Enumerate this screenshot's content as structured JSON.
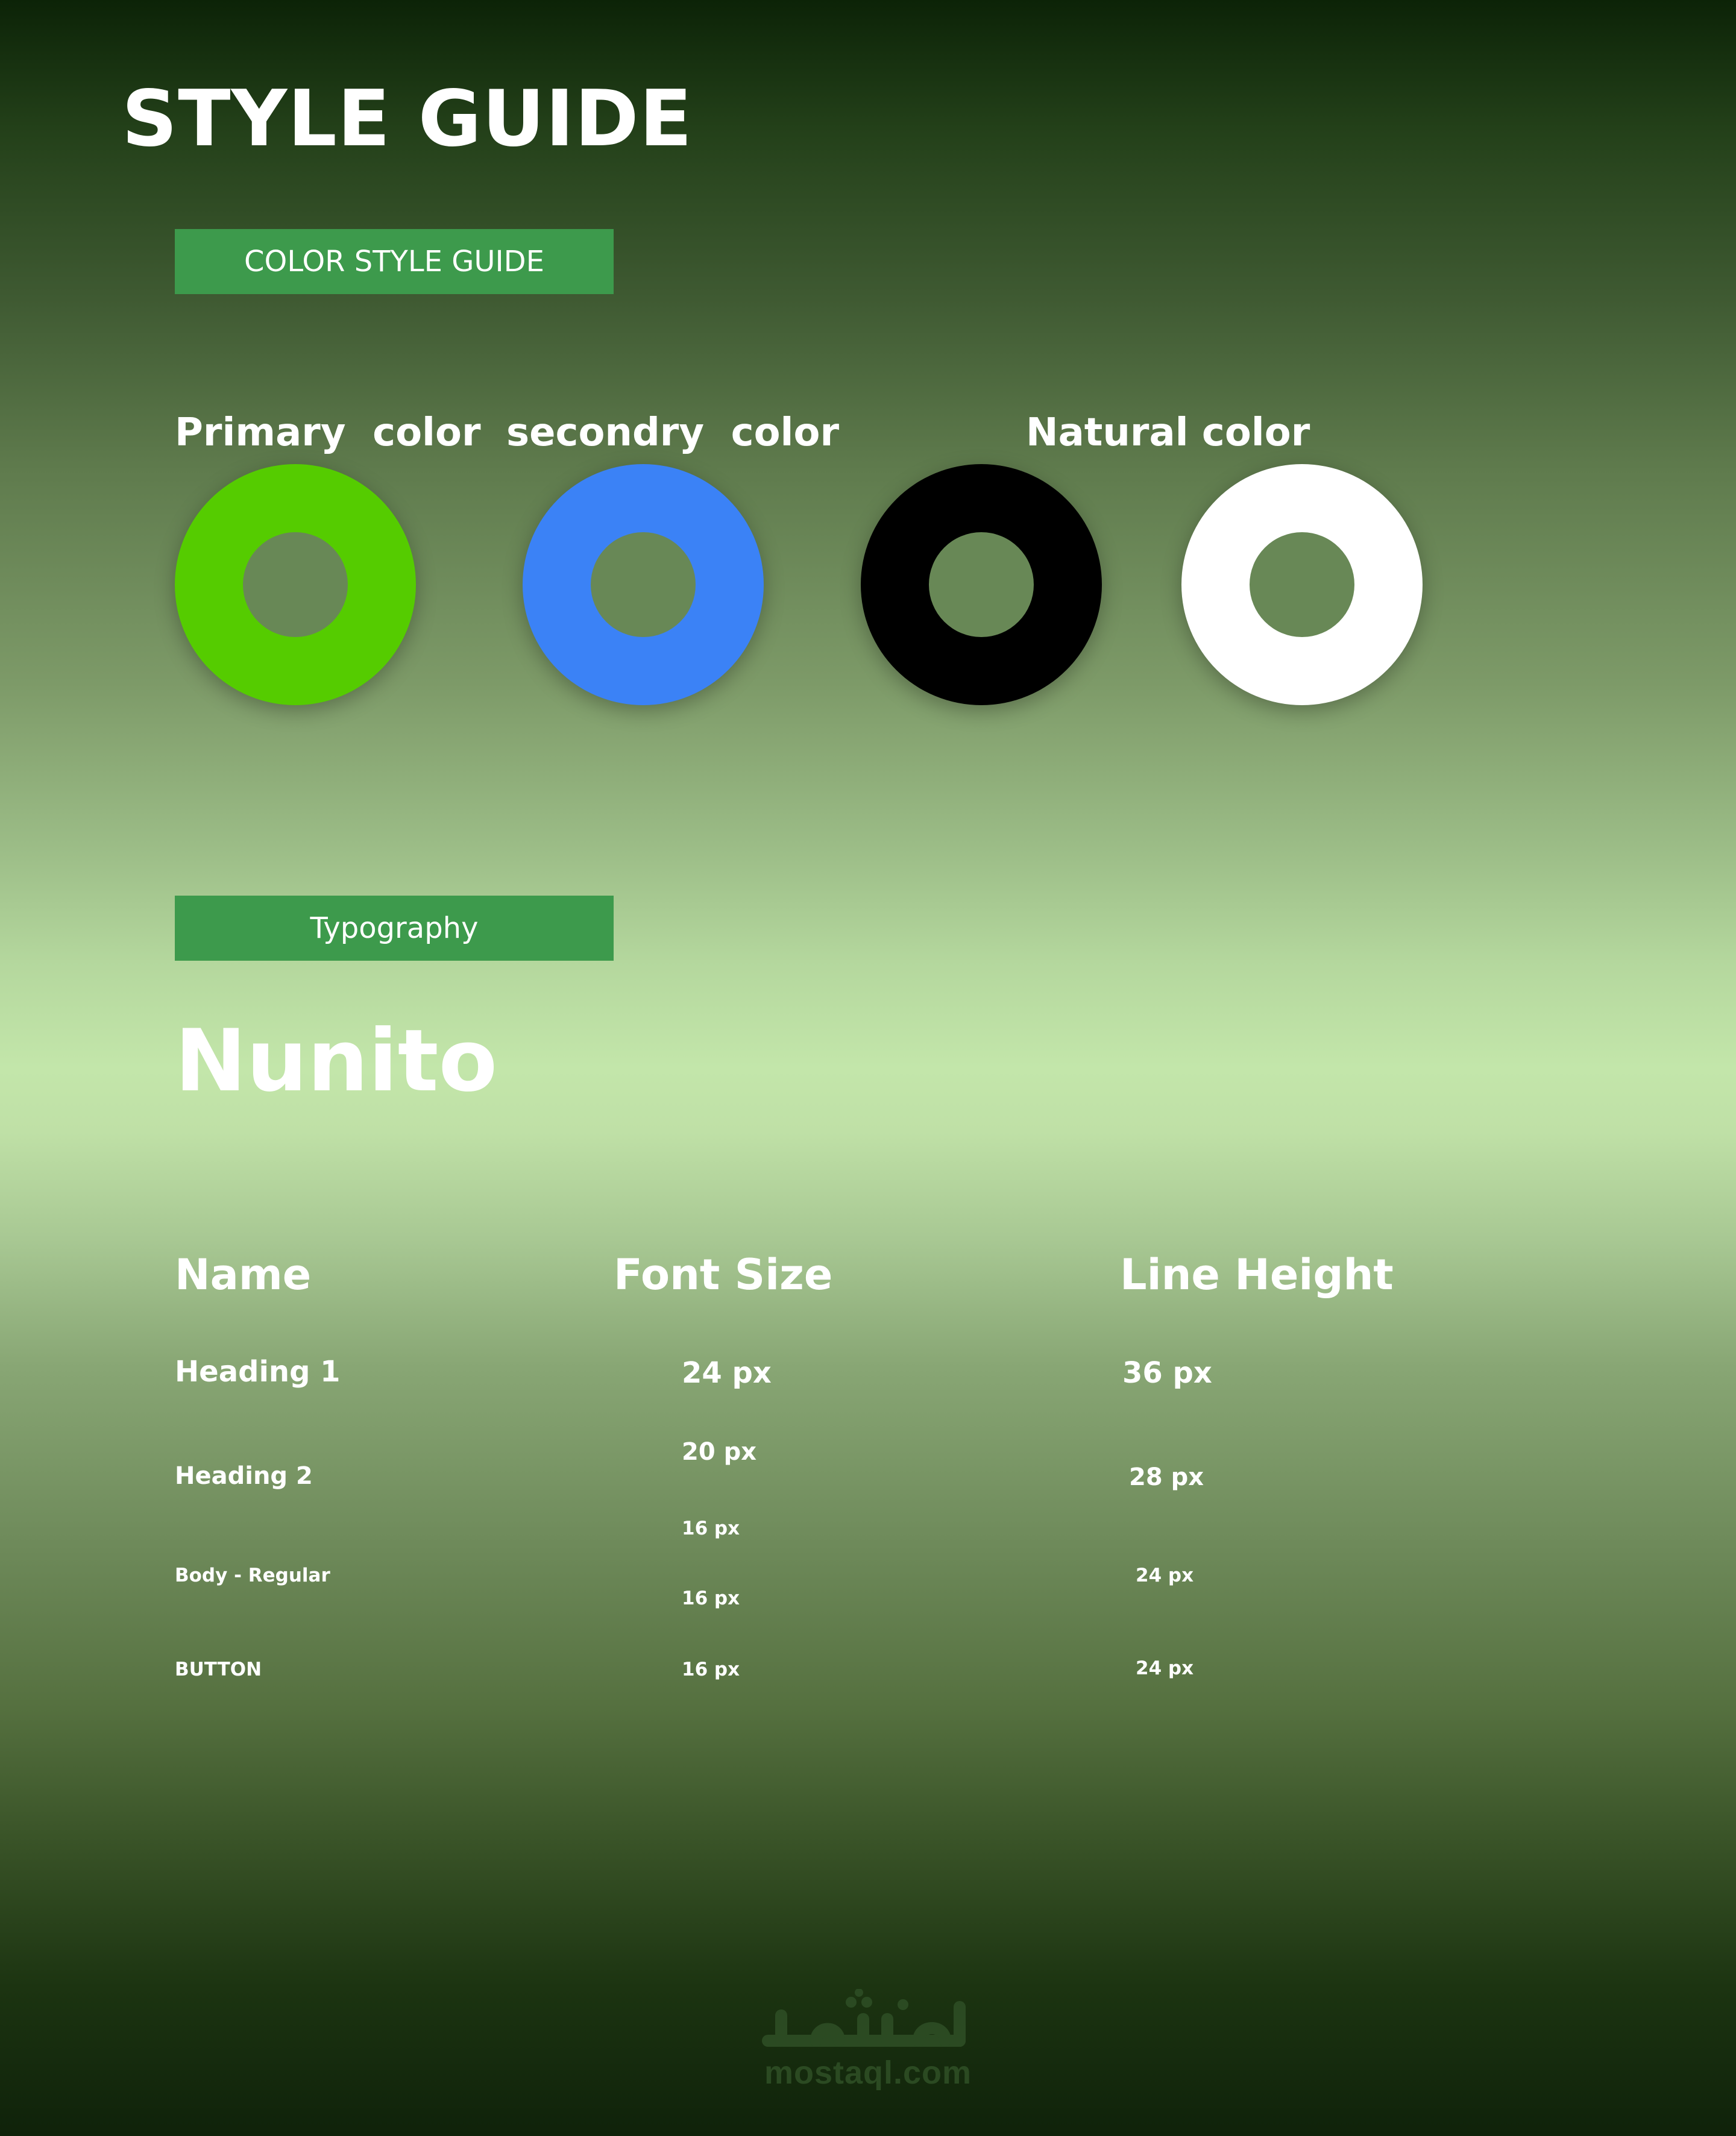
{
  "header": {
    "title": "STYLE GUIDE"
  },
  "color_section": {
    "label": "COLOR STYLE GUIDE",
    "primary_label": "Primary  color",
    "secondary_label": "secondry  color",
    "neutral_label": "Natural color",
    "swatches": [
      {
        "name": "primary",
        "color": "#55cc00"
      },
      {
        "name": "secondary",
        "color": "#3b82f6"
      },
      {
        "name": "neutral-black",
        "color": "#000000"
      },
      {
        "name": "neutral-white",
        "color": "#ffffff"
      }
    ]
  },
  "typography_section": {
    "label": "Typography",
    "font_name": "Nunito",
    "columns": {
      "name": "Name",
      "font_size": "Font Size",
      "line_height": "Line Height"
    },
    "rows": [
      {
        "name": "Heading 1",
        "font_size": "24 px",
        "line_height": "36 px"
      },
      {
        "name": "Heading 2",
        "font_size": "20 px",
        "line_height": "28 px"
      },
      {
        "name": "Body - Regular",
        "font_size": "16 px",
        "line_height": "24 px"
      },
      {
        "name": "BUTTON",
        "font_size": "16 px",
        "line_height": "24 px"
      }
    ],
    "extra_size_above_body": "16 px"
  },
  "watermark": {
    "logo_text": "مستقل",
    "site": "mostaql.com"
  }
}
